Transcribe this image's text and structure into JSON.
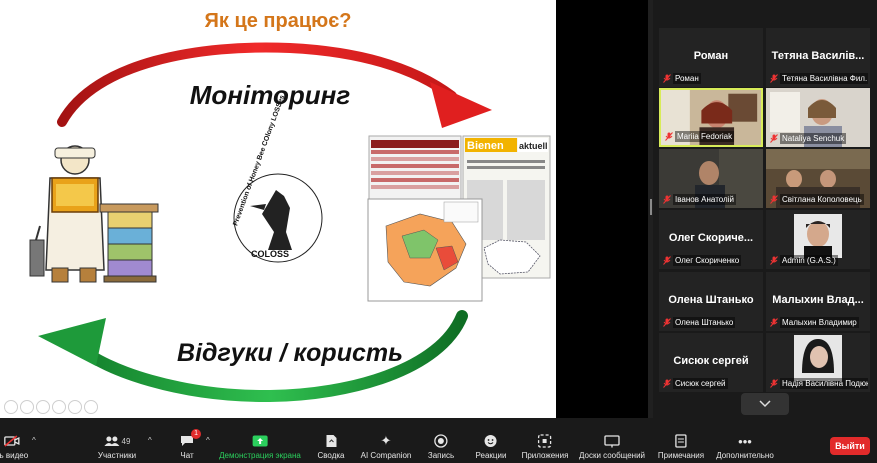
{
  "slide": {
    "title": "Як це працює?",
    "monitoring_label": "Моніторинг",
    "feedback_label": "Відгуки / користь",
    "coloss_ring_text": "Prevention of Honey Bee COlony LOSSes",
    "coloss_word": "COLOSS",
    "newspaper_masthead_1": "Bienen",
    "newspaper_masthead_2": "aktuell"
  },
  "gallery": {
    "tiles": [
      {
        "big_name": "Роман",
        "label": "Роман",
        "muted": true
      },
      {
        "big_name": "Тетяна Василів...",
        "label": "Тетяна Василівна Фил...",
        "muted": true
      },
      {
        "big_name": "",
        "label": "Mariia Fedoriak",
        "muted": true
      },
      {
        "big_name": "",
        "label": "Nataliya Senchuk",
        "muted": true
      },
      {
        "big_name": "",
        "label": "Іванов Анатолій",
        "muted": true
      },
      {
        "big_name": "",
        "label": "Світлана Кополовець",
        "muted": true
      },
      {
        "big_name": "Олег Скориче...",
        "label": "Олег Скориченко",
        "muted": true
      },
      {
        "big_name": "",
        "label": "Admin (G.A.S.)",
        "muted": true
      },
      {
        "big_name": "Олена Штанько",
        "label": "Олена Штанько",
        "muted": true
      },
      {
        "big_name": "Малыхин Влад...",
        "label": "Малыхин Владимир",
        "muted": true
      },
      {
        "big_name": "Сисюк сергей",
        "label": "Сисюк сергей",
        "muted": true
      },
      {
        "big_name": "",
        "label": "Надія Василівна Подюк",
        "muted": true
      }
    ]
  },
  "toolbar": {
    "video_label": "ть видео",
    "participants_label": "Участники",
    "participants_count": "49",
    "chat_label": "Чат",
    "chat_badge": "1",
    "share_label": "Демонстрация экрана",
    "summary_label": "Сводка",
    "ai_label": "AI Companion",
    "record_label": "Запись",
    "reactions_label": "Реакции",
    "apps_label": "Приложения",
    "whiteboards_label": "Доски сообщений",
    "notes_label": "Примечания",
    "more_label": "Дополнительно",
    "leave_label": "Выйти"
  },
  "colors": {
    "title_orange": "#d4761a",
    "arrow_red": "#e01f1f",
    "arrow_green": "#1e9a3a",
    "share_green": "#2bcf5d",
    "leave_red": "#e22b2b",
    "active_border": "#d8ec59"
  }
}
